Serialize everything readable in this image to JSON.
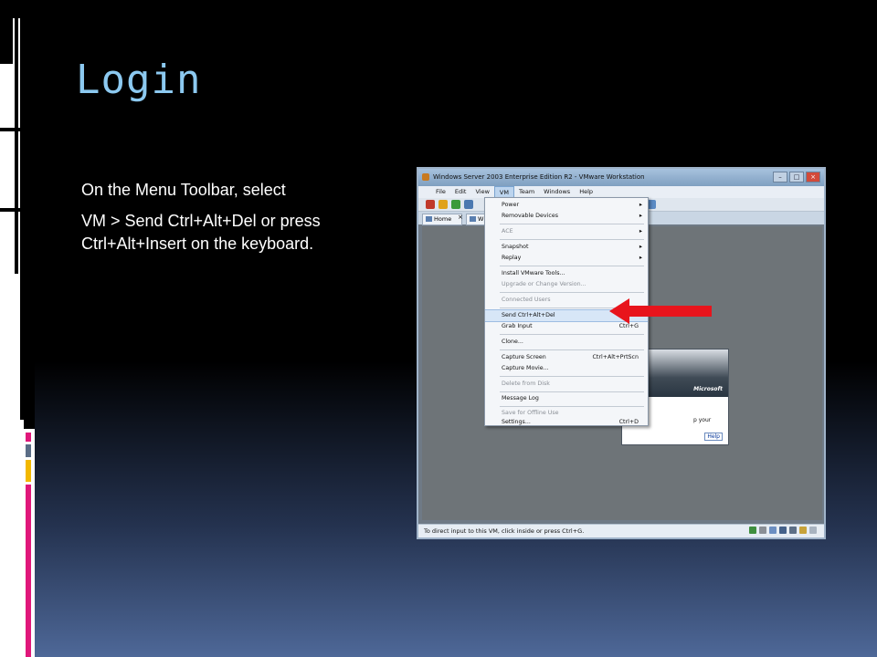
{
  "slide": {
    "title": "Login",
    "paragraphs": [
      "On the Menu Toolbar, select",
      "VM > Send Ctrl+Alt+Del or press Ctrl+Alt+Insert on the keyboard."
    ]
  },
  "window": {
    "title": "Windows Server 2003 Enterprise Edition R2 - VMware Workstation",
    "menu": [
      "File",
      "Edit",
      "View",
      "VM",
      "Team",
      "Windows",
      "Help"
    ],
    "tabs": [
      "Home",
      "W"
    ],
    "status_text": "To direct input to this VM, click inside or press Ctrl+G."
  },
  "vm_menu": {
    "items": [
      {
        "label": "Power",
        "submenu": true
      },
      {
        "label": "Removable Devices",
        "submenu": true
      },
      {
        "label": "ACE",
        "submenu": true,
        "disabled": true
      },
      {
        "label": "Snapshot",
        "submenu": true
      },
      {
        "label": "Replay",
        "submenu": true
      },
      {
        "label": "Install VMware Tools..."
      },
      {
        "label": "Upgrade or Change Version...",
        "disabled": true
      },
      {
        "label": "Connected Users",
        "disabled": true
      },
      {
        "label": "Send Ctrl+Alt+Del",
        "highlighted": true
      },
      {
        "label": "Grab Input",
        "shortcut": "Ctrl+G"
      },
      {
        "label": "Clone..."
      },
      {
        "label": "Capture Screen",
        "shortcut": "Ctrl+Alt+PrtScn"
      },
      {
        "label": "Capture Movie..."
      },
      {
        "label": "Delete from Disk",
        "disabled": true
      },
      {
        "label": "Message Log"
      },
      {
        "label": "Save for Offline Use",
        "disabled": true
      },
      {
        "label": "Settings...",
        "shortcut": "Ctrl+D"
      }
    ]
  },
  "login_dialog": {
    "brand": "Microsoft",
    "hint": "p your",
    "help": "Help"
  },
  "colors": {
    "title": "#8cc9f0",
    "arrow": "#e8141c"
  }
}
